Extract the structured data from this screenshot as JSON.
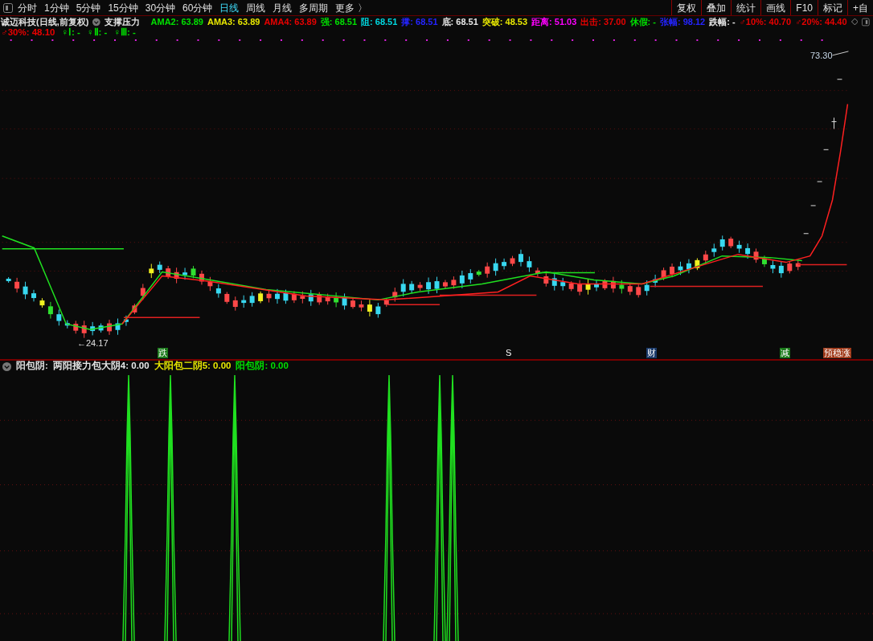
{
  "toolbar": {
    "periods": [
      {
        "label": "分时",
        "selected": false
      },
      {
        "label": "1分钟",
        "selected": false
      },
      {
        "label": "5分钟",
        "selected": false
      },
      {
        "label": "15分钟",
        "selected": false
      },
      {
        "label": "30分钟",
        "selected": false
      },
      {
        "label": "60分钟",
        "selected": false
      },
      {
        "label": "日线",
        "selected": true
      },
      {
        "label": "周线",
        "selected": false
      },
      {
        "label": "月线",
        "selected": false
      },
      {
        "label": "多周期",
        "selected": false
      },
      {
        "label": "更多 〉",
        "selected": false
      }
    ],
    "buttons": [
      "复权",
      "叠加",
      "统计",
      "画线",
      "F10",
      "标记",
      "+自"
    ]
  },
  "main_chart": {
    "title": "诚迈科技(日线,前复权)",
    "formula": "支撑压力",
    "values": [
      {
        "text": "AMA2: 63.89",
        "color": "#00e000"
      },
      {
        "text": "AMA3: 63.89",
        "color": "#e8e800"
      },
      {
        "text": "AMA4: 63.89",
        "color": "#e80000"
      },
      {
        "text": "强: 68.51",
        "color": "#00e000"
      },
      {
        "text": "阻: 68.51",
        "color": "#00d8e0"
      },
      {
        "text": "撑: 68.51",
        "color": "#2424ff"
      },
      {
        "text": "底: 68.51",
        "color": "#e8e8e8"
      },
      {
        "text": "突破: 48.53",
        "color": "#e8e800"
      },
      {
        "text": "距离: 51.03",
        "color": "#ff00ff"
      },
      {
        "text": "出击: 37.00",
        "color": "#e80000"
      },
      {
        "text": "休假: -",
        "color": "#00e000"
      },
      {
        "text": "张幅: 98.12",
        "color": "#2424ff"
      },
      {
        "text": "跌幅: -",
        "color": "#e8e8e8"
      },
      {
        "text": "♂10%: 40.70",
        "color": "#e80000"
      },
      {
        "text": "♂20%: 44.40",
        "color": "#e80000"
      }
    ],
    "values_2": [
      {
        "text": "♂30%: 48.10",
        "color": "#e80000"
      },
      {
        "text": "♀Ⅰ: -",
        "color": "#00e000"
      },
      {
        "text": "♀Ⅱ: -",
        "color": "#00e000"
      },
      {
        "text": "♀Ⅲ: -",
        "color": "#00e000"
      }
    ],
    "high_label": "73.30",
    "low_label": "←24.17",
    "signals": [
      {
        "text": "跌",
        "color": "#1a7a1a"
      },
      {
        "text": "S",
        "color": "#0a0a0a"
      },
      {
        "text": "财",
        "color": "#1a3a6a"
      },
      {
        "text": "减",
        "color": "#1a7a1a"
      },
      {
        "text": "預稳涨",
        "color": "#a03a1a"
      }
    ]
  },
  "indicator": {
    "title": "阳包阴:",
    "values": [
      {
        "text": "两阳接力包大阴4: 0.00",
        "color": "#e8e8e8"
      },
      {
        "text": "大阳包二阴5: 0.00",
        "color": "#e8e800"
      },
      {
        "text": "阳包阴: 0.00",
        "color": "#00e000"
      }
    ]
  }
}
